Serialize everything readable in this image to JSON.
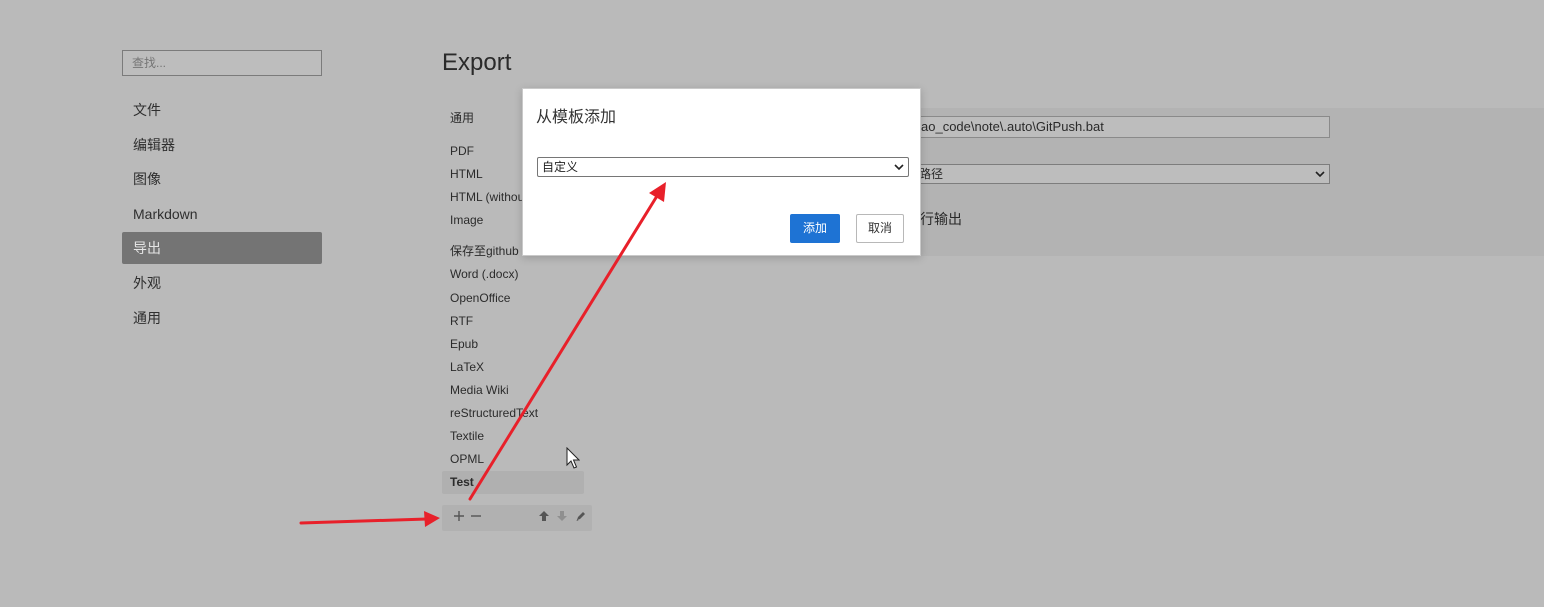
{
  "search": {
    "placeholder": "查找..."
  },
  "sidebar": {
    "items": [
      {
        "label": "文件"
      },
      {
        "label": "编辑器"
      },
      {
        "label": "图像"
      },
      {
        "label": "Markdown"
      },
      {
        "label": "导出",
        "active": true
      },
      {
        "label": "外观"
      },
      {
        "label": "通用"
      }
    ]
  },
  "main": {
    "title": "Export",
    "export_list": {
      "group_title": "通用",
      "formats": [
        "PDF",
        "HTML",
        "HTML (without styles)",
        "Image"
      ],
      "custom": [
        "保存至github",
        "Word (.docx)",
        "OpenOffice",
        "RTF",
        "Epub",
        "LaTeX",
        "Media Wiki",
        "reStructuredText",
        "Textile",
        "OPML",
        "Test"
      ],
      "selected": "Test"
    },
    "toolbar": {
      "add_icon": "plus-icon",
      "remove_icon": "minus-icon",
      "move_up_icon": "arrow-up-icon",
      "move_down_icon": "arrow-down-icon",
      "edit_icon": "pencil-icon"
    },
    "detail": {
      "command_path": "ao_code\\note\\.auto\\GitPush.bat",
      "select_value": "路径",
      "output_text": "行输出"
    }
  },
  "dialog": {
    "title": "从模板添加",
    "template_select": "自定义",
    "add_label": "添加",
    "cancel_label": "取消"
  },
  "colors": {
    "background": "#bababa",
    "primary_button": "#1e73d4",
    "annotation_arrow": "#e8202a"
  }
}
